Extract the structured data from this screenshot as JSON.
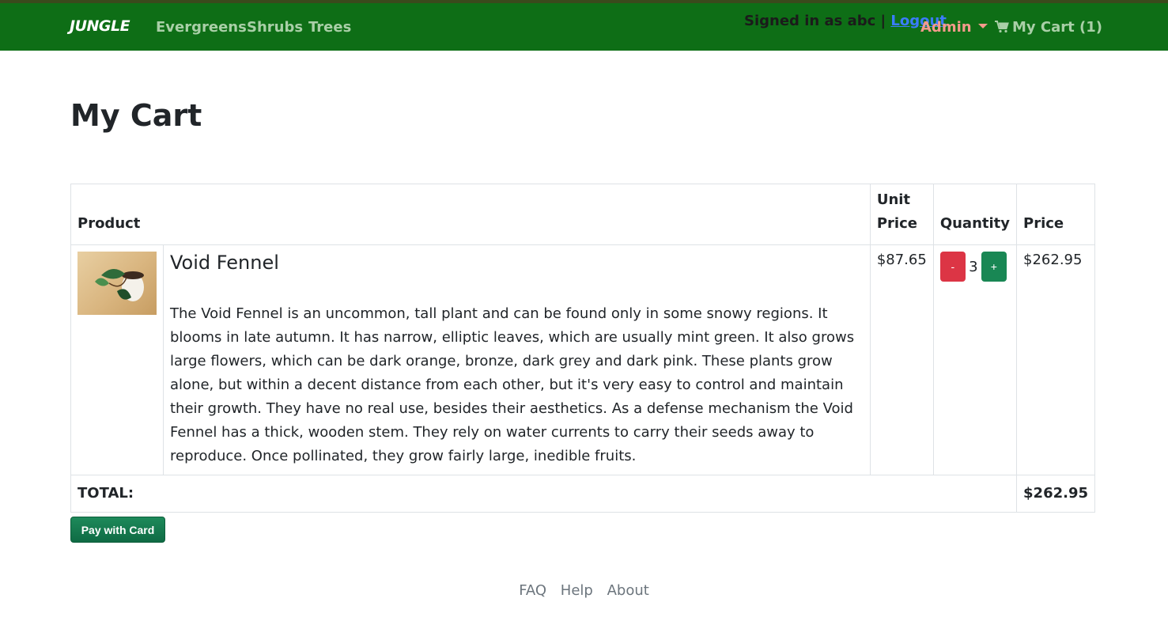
{
  "nav": {
    "brand": "JUNGLE",
    "links": [
      "Evergreens",
      "Shrubs",
      "Trees"
    ],
    "signed_in_text": "Signed in as abc |",
    "logout_label": "Logout",
    "admin_label": "Admin",
    "cart_label": "My Cart (1)"
  },
  "page": {
    "title": "My Cart"
  },
  "table": {
    "headers": {
      "product": "Product",
      "unit_price": "Unit Price",
      "quantity": "Quantity",
      "price": "Price"
    },
    "items": [
      {
        "name": "Void Fennel",
        "description": "The Void Fennel is an uncommon, tall plant and can be found only in some snowy regions. It blooms in late autumn. It has narrow, elliptic leaves, which are usually mint green. It also grows large flowers, which can be dark orange, bronze, dark grey and dark pink. These plants grow alone, but within a decent distance from each other, but it's very easy to control and maintain their growth. They have no real use, besides their aesthetics. As a defense mechanism the Void Fennel has a thick, wooden stem. They rely on water currents to carry their seeds away to reproduce. Once pollinated, they grow fairly large, inedible fruits.",
        "unit_price": "$87.65",
        "quantity": "3",
        "minus_label": "-",
        "plus_label": "+",
        "price": "$262.95"
      }
    ],
    "total_label": "TOTAL:",
    "total_value": "$262.95"
  },
  "pay_label": "Pay with Card",
  "footer": {
    "links": [
      "FAQ",
      "Help",
      "About"
    ]
  },
  "colors": {
    "navbar": "#0e6e16",
    "nav_link": "#a9cfa7",
    "admin": "#f59a8c",
    "minus": "#dc3545",
    "plus": "#198754",
    "pay": "#0f6b44"
  },
  "icons": {
    "cart": "shopping-cart-icon",
    "admin_toggle": "caret-down-icon"
  }
}
